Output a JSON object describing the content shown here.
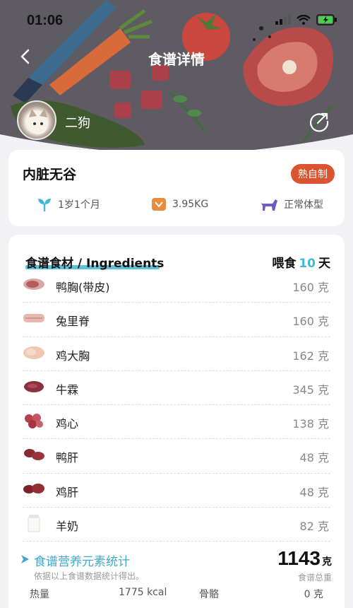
{
  "status_bar": {
    "time": "01:06"
  },
  "header": {
    "title": "食谱详情",
    "owner_name": "二狗"
  },
  "recipe": {
    "name": "内脏无谷",
    "badge": "熟自制",
    "age": "1岁1个月",
    "weight": "3.95KG",
    "body_type": "正常体型"
  },
  "ingredients": {
    "title": "食谱食材 / Ingredients",
    "feed_prefix": "喂食",
    "feed_days": "10",
    "feed_suffix": "天",
    "items": [
      {
        "name": "鸭胸(带皮)",
        "qty": "160 克",
        "icon": "duck-breast-icon"
      },
      {
        "name": "兔里脊",
        "qty": "160 克",
        "icon": "rabbit-tenderloin-icon"
      },
      {
        "name": "鸡大胸",
        "qty": "162 克",
        "icon": "chicken-breast-icon"
      },
      {
        "name": "牛霖",
        "qty": "345 克",
        "icon": "beef-icon"
      },
      {
        "name": "鸡心",
        "qty": "138 克",
        "icon": "chicken-heart-icon"
      },
      {
        "name": "鸭肝",
        "qty": "48 克",
        "icon": "duck-liver-icon"
      },
      {
        "name": "鸡肝",
        "qty": "48 克",
        "icon": "chicken-liver-icon"
      },
      {
        "name": "羊奶",
        "qty": "82 克",
        "icon": "goat-milk-icon"
      }
    ]
  },
  "nutrition": {
    "title": "食谱营养元素统计",
    "subtitle": "依据以上食谱数据统计得出。",
    "total_value": "1143",
    "total_unit": "克",
    "total_label": "食谱总重",
    "rows": [
      {
        "label": "热量",
        "value": "1775 kcal",
        "label2": "骨骼",
        "value2": "0 克"
      }
    ]
  },
  "colors": {
    "accent": "#3fb8d4",
    "badge": "#d9542f",
    "hero": "#5f5b62"
  }
}
